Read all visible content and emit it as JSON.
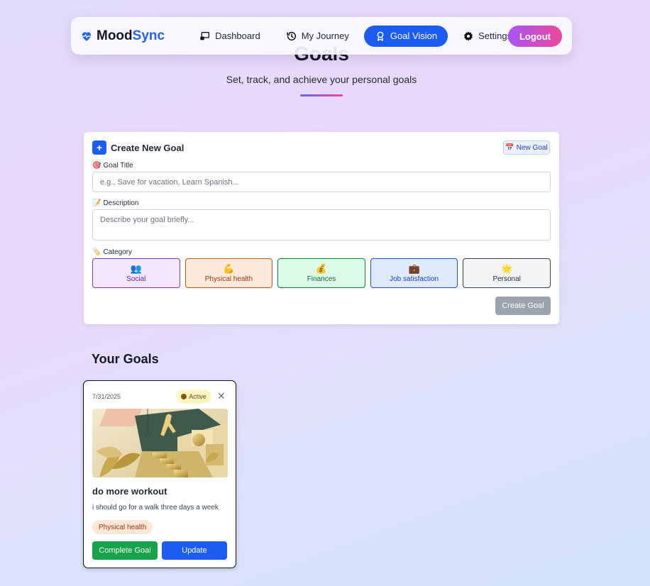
{
  "header": {
    "title": "Goals",
    "subtitle": "Set, track, and achieve your personal goals"
  },
  "navbar": {
    "brand_part1": "Mood",
    "brand_part2": "Sync",
    "links": [
      {
        "label": "Dashboard",
        "icon": "dashboard-icon"
      },
      {
        "label": "My Journey",
        "icon": "history-icon"
      },
      {
        "label": "Goal Vision",
        "icon": "award-icon",
        "active": true
      },
      {
        "label": "Settings",
        "icon": "gear-icon"
      }
    ],
    "logout_label": "Logout"
  },
  "create_goal": {
    "title": "Create New Goal",
    "badge_label": "New Goal",
    "goal_title_label": "Goal Title",
    "goal_title_placeholder": "e.g., Save for vacation, Learn Spanish...",
    "description_label": "Description",
    "description_placeholder": "Describe your goal briefly...",
    "category_label": "Category",
    "categories": [
      {
        "label": "Social",
        "icon": "people-icon"
      },
      {
        "label": "Physical health",
        "icon": "flexed-arm-icon"
      },
      {
        "label": "Finances",
        "icon": "money-bag-icon"
      },
      {
        "label": "Job satisfaction",
        "icon": "briefcase-icon"
      },
      {
        "label": "Personal",
        "icon": "sparkle-icon"
      }
    ],
    "submit_label": "Create Goal"
  },
  "your_goals": {
    "heading": "Your Goals",
    "goals": [
      {
        "date": "7/31/2025",
        "status": "Active",
        "title": "do more workout",
        "description": "i should go for a walk three days a week",
        "category": "Physical health",
        "complete_label": "Complete Goal",
        "update_label": "Update"
      }
    ]
  },
  "colors": {
    "primary": "#1d5cf3",
    "logout_gradient_start": "#a855f7",
    "logout_gradient_end": "#ec4899",
    "complete_green": "#16a34a"
  }
}
